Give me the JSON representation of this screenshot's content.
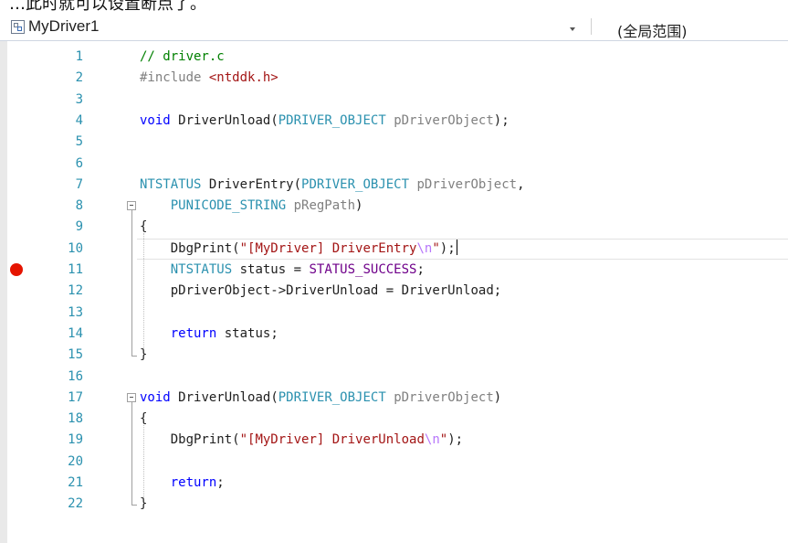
{
  "top_text": "…此时就可以设置断点了。",
  "navbar": {
    "project": "MyDriver1",
    "scope": "(全局范围)"
  },
  "editor": {
    "lines": [
      {
        "n": "1",
        "code": "// driver.c"
      },
      {
        "n": "2",
        "code": "#include <ntddk.h>"
      },
      {
        "n": "3",
        "code": ""
      },
      {
        "n": "4",
        "code": "void DriverUnload(PDRIVER_OBJECT pDriverObject);"
      },
      {
        "n": "5",
        "code": ""
      },
      {
        "n": "6",
        "code": ""
      },
      {
        "n": "7",
        "code": "NTSTATUS DriverEntry(PDRIVER_OBJECT pDriverObject,"
      },
      {
        "n": "8",
        "code": "    PUNICODE_STRING pRegPath)"
      },
      {
        "n": "9",
        "code": "{"
      },
      {
        "n": "10",
        "code": "    DbgPrint(\"[MyDriver] DriverEntry\\n\");"
      },
      {
        "n": "11",
        "code": "    NTSTATUS status = STATUS_SUCCESS;"
      },
      {
        "n": "12",
        "code": "    pDriverObject->DriverUnload = DriverUnload;"
      },
      {
        "n": "13",
        "code": ""
      },
      {
        "n": "14",
        "code": "    return status;"
      },
      {
        "n": "15",
        "code": "}"
      },
      {
        "n": "16",
        "code": ""
      },
      {
        "n": "17",
        "code": "void DriverUnload(PDRIVER_OBJECT pDriverObject)"
      },
      {
        "n": "18",
        "code": "{"
      },
      {
        "n": "19",
        "code": "    DbgPrint(\"[MyDriver] DriverUnload\\n\");"
      },
      {
        "n": "20",
        "code": ""
      },
      {
        "n": "21",
        "code": "    return;"
      },
      {
        "n": "22",
        "code": "}"
      }
    ],
    "breakpoint_line": "11",
    "current_line": "10"
  },
  "colors": {
    "keyword": "#0000ff",
    "comment": "#008000",
    "string": "#a31515",
    "escape": "#b776fb",
    "type": "#2b91af",
    "macro": "#6f008a",
    "param": "#808080",
    "preprocessor": "#808080",
    "line_number": "#2b91af",
    "breakpoint": "#e51400"
  },
  "icons": {
    "project": "project-icon",
    "dropdown": "chevron-down-icon",
    "breakpoint": "breakpoint-icon",
    "fold": "collapse-icon"
  }
}
